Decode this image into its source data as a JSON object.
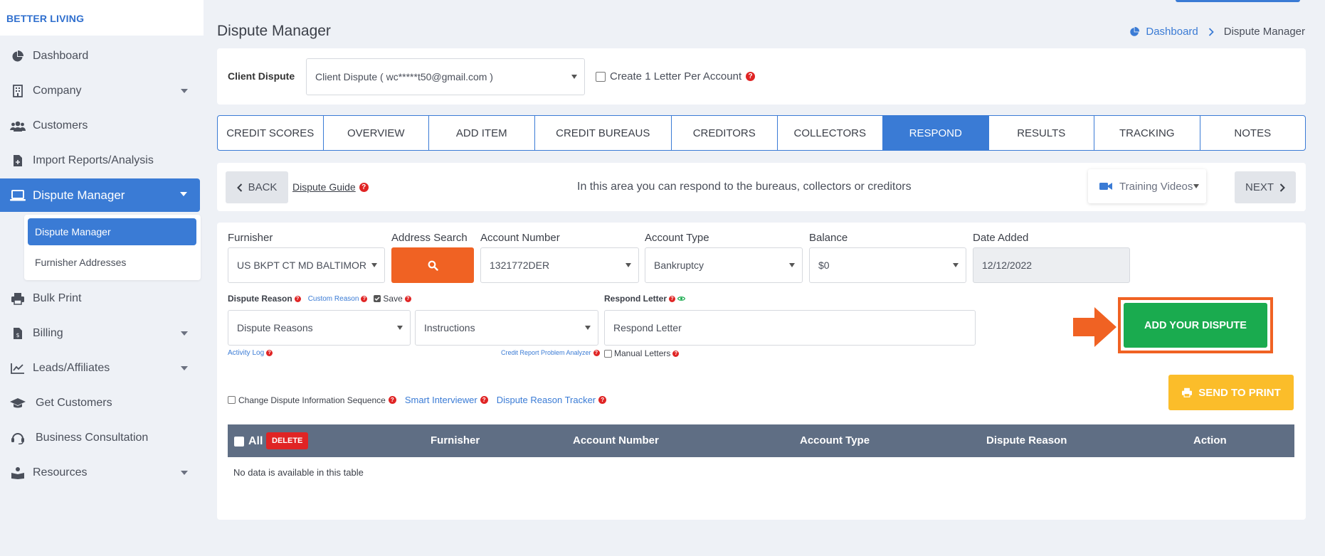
{
  "brand": "BETTER LIVING",
  "sidebar": {
    "items": [
      {
        "label": "Dashboard"
      },
      {
        "label": "Company"
      },
      {
        "label": "Customers"
      },
      {
        "label": "Import Reports/Analysis"
      },
      {
        "label": "Dispute Manager"
      },
      {
        "label": "Bulk Print"
      },
      {
        "label": "Billing"
      },
      {
        "label": "Leads/Affiliates"
      },
      {
        "label": "Get Customers"
      },
      {
        "label": "Business Consultation"
      },
      {
        "label": "Resources"
      }
    ],
    "submenu": [
      {
        "label": "Dispute Manager"
      },
      {
        "label": "Furnisher Addresses"
      }
    ]
  },
  "header": {
    "title": "Dispute Manager",
    "breadcrumb": {
      "home": "Dashboard",
      "current": "Dispute Manager"
    }
  },
  "client_bar": {
    "label": "Client Dispute",
    "select_value": "Client Dispute ( wc*****t50@gmail.com )",
    "checkbox_label": "Create 1 Letter Per Account"
  },
  "tabs": [
    {
      "label": "CREDIT SCORES"
    },
    {
      "label": "OVERVIEW"
    },
    {
      "label": "ADD ITEM"
    },
    {
      "label": "CREDIT BUREAUS"
    },
    {
      "label": "CREDITORS"
    },
    {
      "label": "COLLECTORS"
    },
    {
      "label": "RESPOND"
    },
    {
      "label": "RESULTS"
    },
    {
      "label": "TRACKING"
    },
    {
      "label": "NOTES"
    }
  ],
  "nav_bar": {
    "back": "BACK",
    "guide": "Dispute Guide",
    "info": "In this area you can respond to the bureaus, collectors or creditors",
    "training": "Training Videos",
    "next": "NEXT"
  },
  "form": {
    "furnisher": {
      "label": "Furnisher",
      "value": "US BKPT CT MD BALTIMOR"
    },
    "address_search": {
      "label": "Address Search"
    },
    "account_number": {
      "label": "Account Number",
      "value": "1321772DER"
    },
    "account_type": {
      "label": "Account Type",
      "value": "Bankruptcy"
    },
    "balance": {
      "label": "Balance",
      "value": "$0"
    },
    "date_added": {
      "label": "Date Added",
      "value": "12/12/2022"
    },
    "dispute_reason_label": "Dispute Reason",
    "custom_reason": "Custom Reason",
    "save_label": "Save",
    "respond_letter_label": "Respond Letter",
    "dispute_reasons_value": "Dispute Reasons",
    "instructions_value": "Instructions",
    "respond_letter_value": "Respond Letter",
    "activity_log": "Activity Log",
    "credit_report_analyzer": "Credit Report Problem Analyzer",
    "manual_letters": "Manual Letters",
    "add_dispute": "ADD YOUR DISPUTE",
    "change_sequence": "Change Dispute Information Sequence",
    "smart_interviewer": "Smart Interviewer",
    "reason_tracker": "Dispute Reason Tracker",
    "send_to_print": "SEND TO PRINT"
  },
  "table": {
    "all_label": "All",
    "delete_label": "DELETE",
    "columns": [
      "Furnisher",
      "Account Number",
      "Account Type",
      "Dispute Reason",
      "Action"
    ],
    "empty": "No data is available in this table"
  },
  "colors": {
    "primary": "#3a7bd5",
    "orange": "#f06223",
    "green": "#1aab4f",
    "yellow": "#fbbd2a",
    "red": "#e02424"
  }
}
